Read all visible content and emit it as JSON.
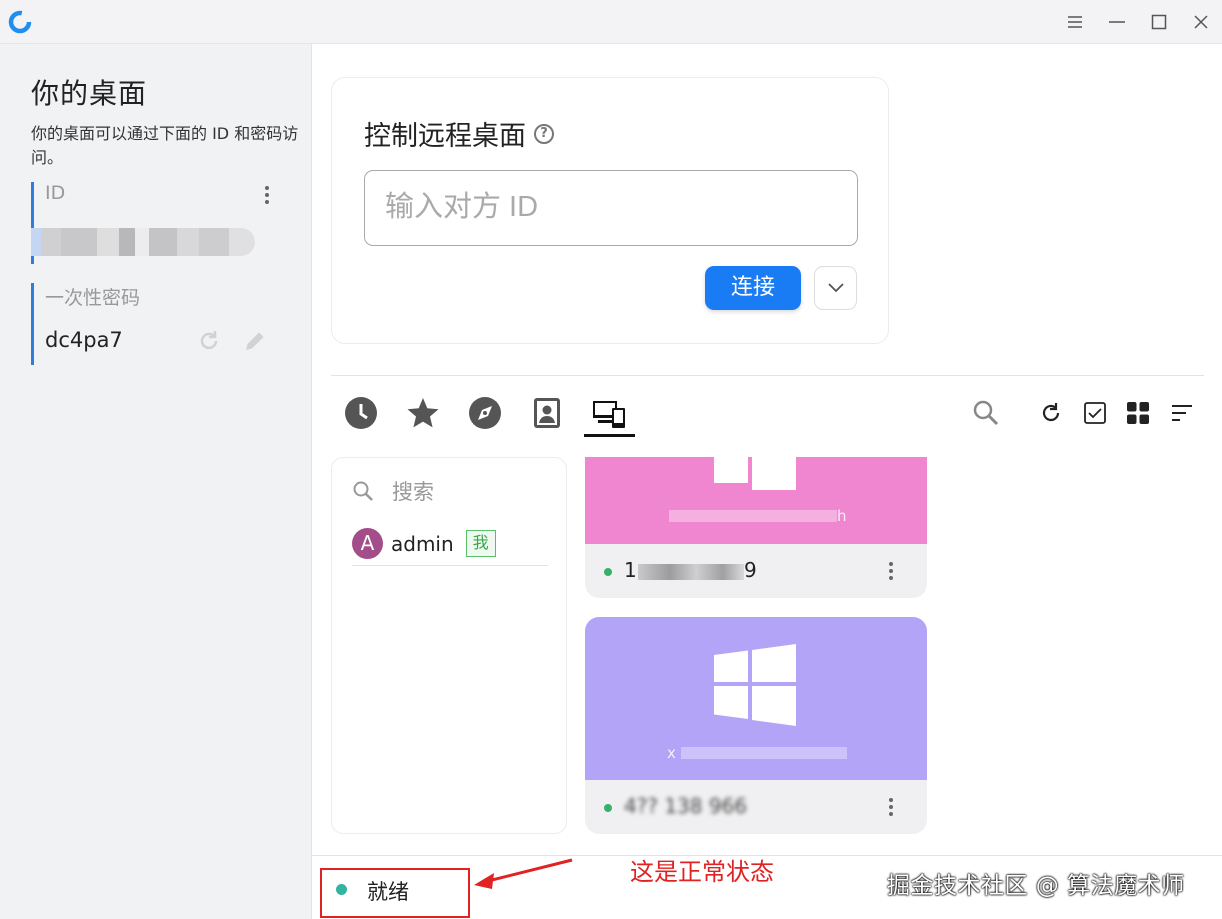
{
  "window": {
    "logo_icon": "rustdesk-logo",
    "controls": [
      "menu-icon",
      "minimize-icon",
      "maximize-icon",
      "close-icon"
    ]
  },
  "left_panel": {
    "title": "你的桌面",
    "description": "你的桌面可以通过下面的 ID 和密码访问。",
    "id_label": "ID",
    "password_label": "一次性密码",
    "password_value": "dc4pa7"
  },
  "connect_card": {
    "title": "控制远程桌面",
    "input_placeholder": "输入对方 ID",
    "connect_label": "连接"
  },
  "tabs": [
    "recent-icon",
    "favorites-icon",
    "discovered-icon",
    "address-book-icon",
    "group-icon"
  ],
  "active_tab": "group-icon",
  "tools": [
    "search-icon",
    "refresh-icon",
    "select-icon",
    "grid-view-icon",
    "sort-icon"
  ],
  "address_book": {
    "search_placeholder": "搜索",
    "user_initial": "A",
    "user_name": "admin",
    "me_badge": "我"
  },
  "peers": [
    {
      "name_visible": "h",
      "id_visible_start": "1",
      "id_visible_end": "9",
      "color": "#ef86cf",
      "online": true
    },
    {
      "name_visible": "x",
      "id_visible": "4?? 138 966",
      "color": "#b3a4f7",
      "online": true
    }
  ],
  "status": {
    "text": "就绪",
    "annotation": "这是正常状态",
    "watermark": "掘金技术社区 @ 算法魔术师"
  },
  "colors": {
    "accent": "#1a7cf5",
    "status_dot": "#2fb5a0",
    "annotation_red": "#e02222"
  }
}
